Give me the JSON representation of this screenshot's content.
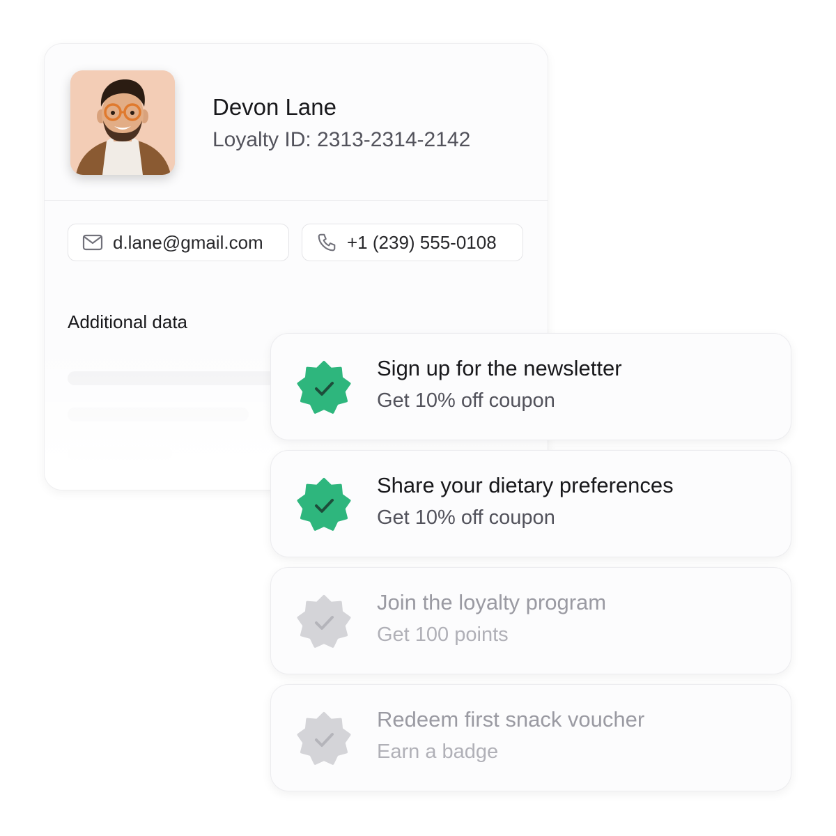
{
  "profile": {
    "name": "Devon Lane",
    "loyalty_id": "Loyalty ID: 2313-2314-2142",
    "email": "d.lane@gmail.com",
    "phone": "+1 (239) 555-0108",
    "additional_title": "Additional data"
  },
  "tasks": [
    {
      "title": "Sign up for the newsletter",
      "subtitle": "Get 10% off coupon",
      "status": "completed"
    },
    {
      "title": "Share your dietary preferences",
      "subtitle": "Get 10% off coupon",
      "status": "completed"
    },
    {
      "title": "Join the loyalty program",
      "subtitle": "Get 100 points",
      "status": "pending"
    },
    {
      "title": "Redeem first snack voucher",
      "subtitle": "Earn a badge",
      "status": "pending"
    }
  ],
  "colors": {
    "completed_badge": "#2eb67d",
    "pending_badge": "#d4d4d8",
    "avatar_bg": "#f3cdb6"
  },
  "icons": {
    "email": "mail-icon",
    "phone": "phone-icon",
    "badge": "verified-badge-icon",
    "check": "checkmark-icon"
  }
}
